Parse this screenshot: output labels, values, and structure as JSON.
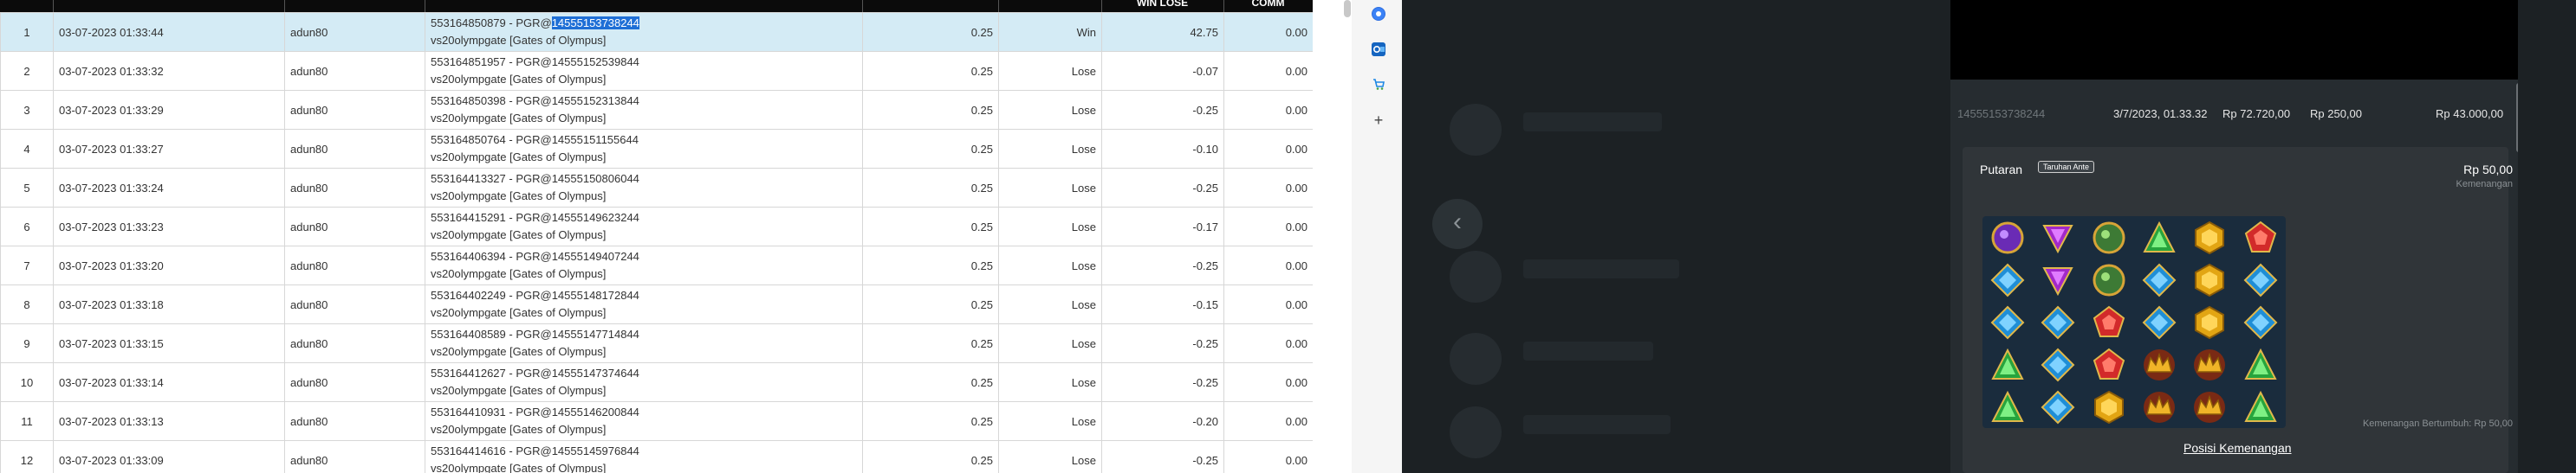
{
  "table": {
    "headers": {
      "win_lose": "WIN LOSE",
      "comm": "COMM"
    },
    "rows": [
      {
        "idx": "1",
        "datetime": "03-07-2023 01:33:44",
        "user": "adun80",
        "desc_prefix": "553164850879 - PGR@",
        "desc_code": "14555153738244",
        "desc_game": "vs20olympgate [Gates of Olympus]",
        "amount": "0.25",
        "result": "Win",
        "winlose": "42.75",
        "comm": "0.00"
      },
      {
        "idx": "2",
        "datetime": "03-07-2023 01:33:32",
        "user": "adun80",
        "desc_prefix": "553164851957 - PGR@",
        "desc_code": "14555152539844",
        "desc_game": "vs20olympgate [Gates of Olympus]",
        "amount": "0.25",
        "result": "Lose",
        "winlose": "-0.07",
        "comm": "0.00"
      },
      {
        "idx": "3",
        "datetime": "03-07-2023 01:33:29",
        "user": "adun80",
        "desc_prefix": "553164850398 - PGR@",
        "desc_code": "14555152313844",
        "desc_game": "vs20olympgate [Gates of Olympus]",
        "amount": "0.25",
        "result": "Lose",
        "winlose": "-0.25",
        "comm": "0.00"
      },
      {
        "idx": "4",
        "datetime": "03-07-2023 01:33:27",
        "user": "adun80",
        "desc_prefix": "553164850764 - PGR@",
        "desc_code": "14555151155644",
        "desc_game": "vs20olympgate [Gates of Olympus]",
        "amount": "0.25",
        "result": "Lose",
        "winlose": "-0.10",
        "comm": "0.00"
      },
      {
        "idx": "5",
        "datetime": "03-07-2023 01:33:24",
        "user": "adun80",
        "desc_prefix": "553164413327 - PGR@",
        "desc_code": "14555150806044",
        "desc_game": "vs20olympgate [Gates of Olympus]",
        "amount": "0.25",
        "result": "Lose",
        "winlose": "-0.25",
        "comm": "0.00"
      },
      {
        "idx": "6",
        "datetime": "03-07-2023 01:33:23",
        "user": "adun80",
        "desc_prefix": "553164415291 - PGR@",
        "desc_code": "14555149623244",
        "desc_game": "vs20olympgate [Gates of Olympus]",
        "amount": "0.25",
        "result": "Lose",
        "winlose": "-0.17",
        "comm": "0.00"
      },
      {
        "idx": "7",
        "datetime": "03-07-2023 01:33:20",
        "user": "adun80",
        "desc_prefix": "553164406394 - PGR@",
        "desc_code": "14555149407244",
        "desc_game": "vs20olympgate [Gates of Olympus]",
        "amount": "0.25",
        "result": "Lose",
        "winlose": "-0.25",
        "comm": "0.00"
      },
      {
        "idx": "8",
        "datetime": "03-07-2023 01:33:18",
        "user": "adun80",
        "desc_prefix": "553164402249 - PGR@",
        "desc_code": "14555148172844",
        "desc_game": "vs20olympgate [Gates of Olympus]",
        "amount": "0.25",
        "result": "Lose",
        "winlose": "-0.15",
        "comm": "0.00"
      },
      {
        "idx": "9",
        "datetime": "03-07-2023 01:33:15",
        "user": "adun80",
        "desc_prefix": "553164408589 - PGR@",
        "desc_code": "14555147714844",
        "desc_game": "vs20olympgate [Gates of Olympus]",
        "amount": "0.25",
        "result": "Lose",
        "winlose": "-0.25",
        "comm": "0.00"
      },
      {
        "idx": "10",
        "datetime": "03-07-2023 01:33:14",
        "user": "adun80",
        "desc_prefix": "553164412627 - PGR@",
        "desc_code": "14555147374644",
        "desc_game": "vs20olympgate [Gates of Olympus]",
        "amount": "0.25",
        "result": "Lose",
        "winlose": "-0.25",
        "comm": "0.00"
      },
      {
        "idx": "11",
        "datetime": "03-07-2023 01:33:13",
        "user": "adun80",
        "desc_prefix": "553164410931 - PGR@",
        "desc_code": "14555146200844",
        "desc_game": "vs20olympgate [Gates of Olympus]",
        "amount": "0.25",
        "result": "Lose",
        "winlose": "-0.20",
        "comm": "0.00"
      },
      {
        "idx": "12",
        "datetime": "03-07-2023 01:33:09",
        "user": "adun80",
        "desc_prefix": "553164414616 - PGR@",
        "desc_code": "14555145976844",
        "desc_game": "vs20olympgate [Gates of Olympus]",
        "amount": "0.25",
        "result": "Lose",
        "winlose": "-0.25",
        "comm": "0.00"
      }
    ]
  },
  "sidebar_icons": [
    "copilot-icon",
    "outlook-icon",
    "shopping-icon",
    "add-icon"
  ],
  "game_detail": {
    "summary": {
      "round_id": "14555153738244",
      "datetime": "3/7/2023, 01.33.32",
      "balance_before": "Rp 72.720,00",
      "bet": "Rp 250,00",
      "balance_after": "Rp 43.000,00"
    },
    "spin_title": "Putaran",
    "bet_badge": "Taruhan Ante",
    "spin_amount": "Rp 50,00",
    "win_label": "Kemenangan",
    "total_win": "Kemenangan Bertumbuh: Rp 50,00",
    "win_position_link": "Posisi Kemenangan",
    "grid_symbols": [
      [
        "purple-orb",
        "purple-triangle",
        "green-orb",
        "green-triangle",
        "gold-hexagon",
        "red-pentagon"
      ],
      [
        "blue-diamond",
        "purple-triangle",
        "green-orb",
        "blue-diamond",
        "gold-hexagon",
        "blue-diamond"
      ],
      [
        "blue-diamond",
        "blue-diamond",
        "red-pentagon",
        "blue-diamond",
        "gold-hexagon",
        "blue-diamond"
      ],
      [
        "green-triangle",
        "blue-diamond",
        "red-pentagon",
        "crown",
        "crown",
        "green-triangle"
      ],
      [
        "green-triangle",
        "blue-diamond",
        "gold-hexagon",
        "crown",
        "crown",
        "green-triangle"
      ]
    ]
  },
  "colors": {
    "win": "#2e8b2e",
    "lose": "#e0141e",
    "selected_row": "#d4ebf5",
    "highlight": "#1f6fd6",
    "overlay": "#1c2124",
    "panel": "#262c30"
  }
}
